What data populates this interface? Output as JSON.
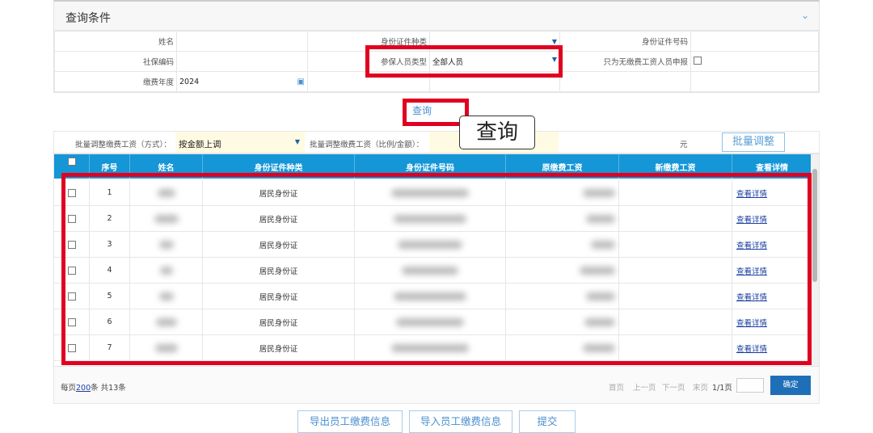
{
  "query_panel": {
    "title": "查询条件",
    "fields": {
      "name": "姓名",
      "id_type": "身份证件种类",
      "id_number": "身份证件号码",
      "social_code": "社保编码",
      "person_type": "参保人员类型",
      "person_type_value": "全部人员",
      "only_no_wage": "只为无缴费工资人员申报",
      "year": "缴费年度",
      "year_value": "2024"
    }
  },
  "query_button": "查询",
  "callout": "查询",
  "batch": {
    "method_label": "批量调整缴费工资（方式）：",
    "method_value": "按金额上调",
    "amount_label": "批量调整缴费工资（比例/金额）：",
    "unit": "元",
    "button": "批量调整"
  },
  "table": {
    "headers": [
      "序号",
      "姓名",
      "身份证件种类",
      "身份证件号码",
      "原缴费工资",
      "新缴费工资",
      "查看详情"
    ],
    "rows": [
      {
        "no": "1",
        "id_type": "居民身份证",
        "link": "查看详情"
      },
      {
        "no": "2",
        "id_type": "居民身份证",
        "link": "查看详情"
      },
      {
        "no": "3",
        "id_type": "居民身份证",
        "link": "查看详情"
      },
      {
        "no": "4",
        "id_type": "居民身份证",
        "link": "查看详情"
      },
      {
        "no": "5",
        "id_type": "居民身份证",
        "link": "查看详情"
      },
      {
        "no": "6",
        "id_type": "居民身份证",
        "link": "查看详情"
      },
      {
        "no": "7",
        "id_type": "居民身份证",
        "link": "查看详情"
      }
    ]
  },
  "pagination": {
    "per_page_prefix": "每页",
    "per_page": "200",
    "per_page_suffix": "条 共13条",
    "first": "首页",
    "prev": "上一页",
    "next": "下一页",
    "last": "末页",
    "page_info": "1/1页",
    "confirm": "确定"
  },
  "actions": {
    "export": "导出员工缴费信息",
    "import": "导入员工缴费信息",
    "submit": "提交"
  }
}
